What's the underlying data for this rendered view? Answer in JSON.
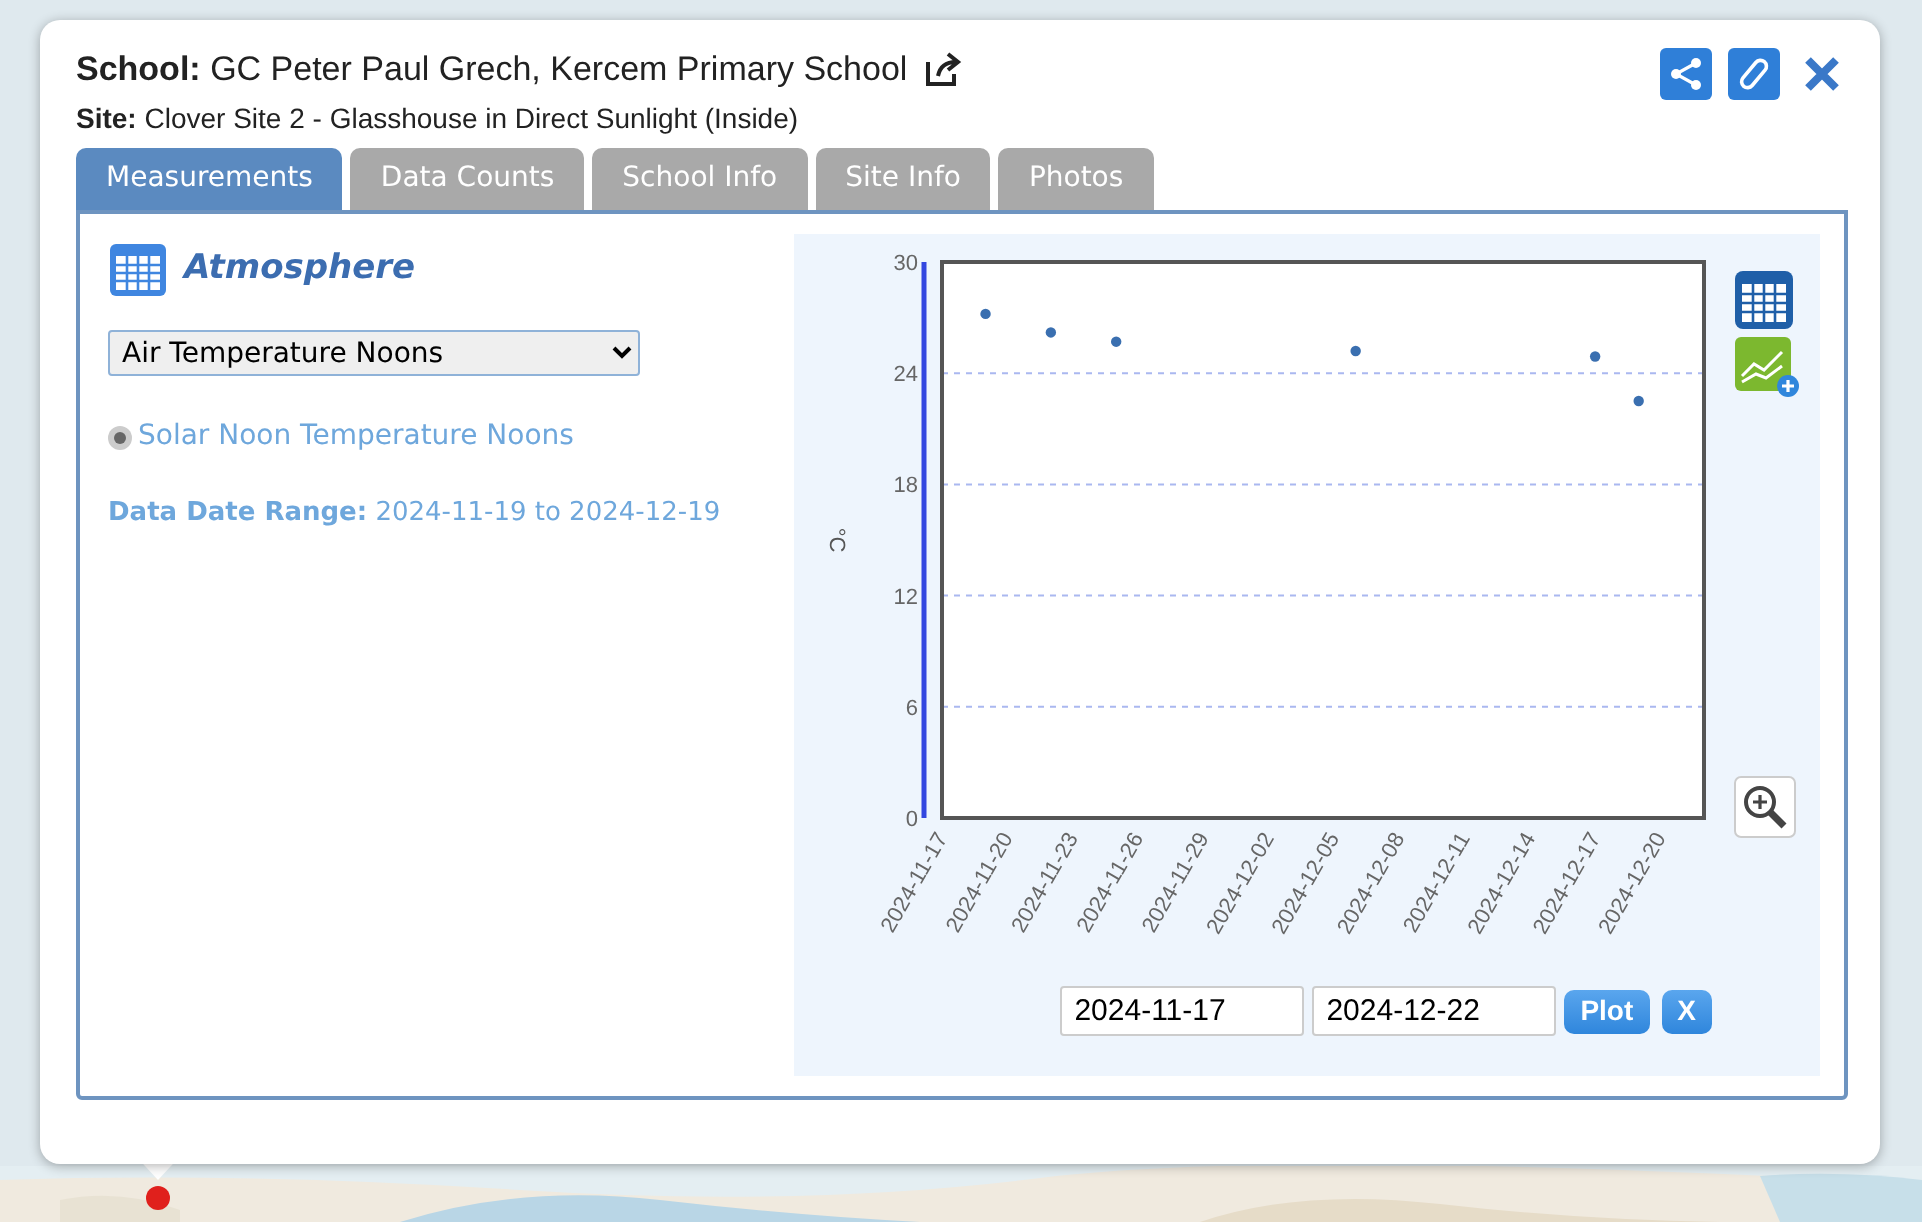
{
  "popup": {
    "school_label": "School:",
    "school": "GC Peter Paul Grech, Kercem Primary School",
    "site_label": "Site:",
    "site": "Clover Site 2 - Glasshouse in Direct Sunlight (Inside)"
  },
  "tabs": [
    {
      "label": "Measurements",
      "selected": true
    },
    {
      "label": "Data Counts",
      "selected": false
    },
    {
      "label": "School Info",
      "selected": false
    },
    {
      "label": "Site Info",
      "selected": false
    },
    {
      "label": "Photos",
      "selected": false
    }
  ],
  "panel": {
    "title": "Atmosphere",
    "dropdown": {
      "value": "Air Temperature Noons"
    },
    "radios": [
      {
        "label": "Solar Noon Temperature Noons",
        "selected": true
      }
    ],
    "range_label": "Data Date Range:",
    "range_value": "2024-11-19 to 2024-12-19"
  },
  "chart": {
    "chart_data": {
      "type": "scatter",
      "ylabel": "°C",
      "grid": true,
      "x": [
        "2024-11-19",
        "2024-11-22",
        "2024-11-25",
        "2024-12-06",
        "2024-12-17",
        "2024-12-19"
      ],
      "series": [
        {
          "color": "#3a6fb0",
          "values": [
            27.2,
            26.2,
            25.7,
            25.2,
            24.9,
            22.5
          ]
        }
      ],
      "xlim": [
        "2024-11-17",
        "2024-12-22"
      ],
      "ylim": [
        0,
        30
      ],
      "yticks": [
        0,
        6,
        12,
        18,
        24,
        30
      ],
      "xticks": [
        {
          "value": "2024-11-17",
          "label": "2024-11-17"
        },
        {
          "value": "2024-11-20",
          "label": "2024-11-20"
        },
        {
          "value": "2024-11-23",
          "label": "2024-11-23"
        },
        {
          "value": "2024-11-26",
          "label": "2024-11-26"
        },
        {
          "value": "2024-11-29",
          "label": "2024-11-29"
        },
        {
          "value": "2024-12-02",
          "label": "2024-12-02"
        },
        {
          "value": "2024-12-05",
          "label": "2024-12-05"
        },
        {
          "value": "2024-12-08",
          "label": "2024-12-08"
        },
        {
          "value": "2024-12-11",
          "label": "2024-12-11"
        },
        {
          "value": "2024-12-14",
          "label": "2024-12-14"
        },
        {
          "value": "2024-12-17",
          "label": "2024-12-17"
        },
        {
          "value": "2024-12-20",
          "label": "2024-12-20"
        }
      ]
    },
    "start_date": "2024-11-17",
    "end_date": "2024-12-22",
    "buttons": [
      "Plot",
      "X"
    ]
  }
}
